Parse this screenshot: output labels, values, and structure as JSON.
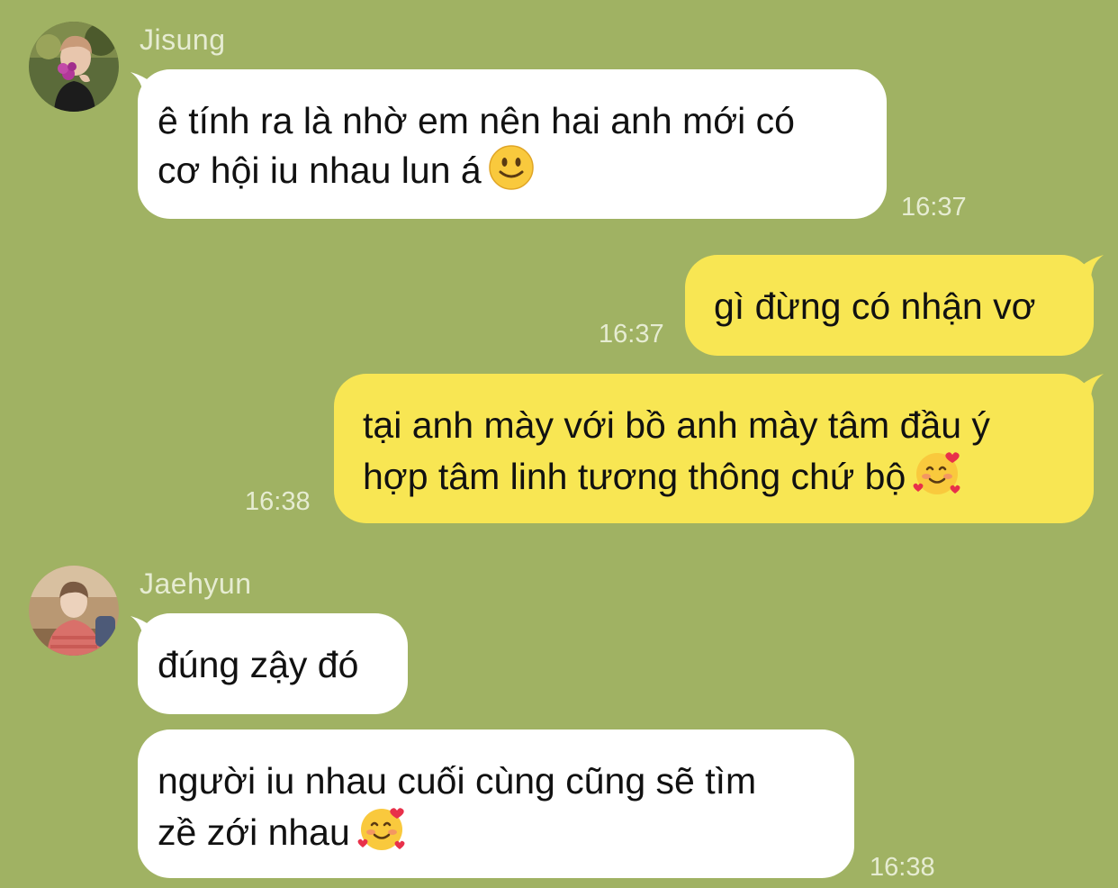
{
  "chat": {
    "messages": [
      {
        "sender": "Jisung",
        "direction": "incoming",
        "lines": [
          "ê tính ra là nhờ em nên hai anh mới có",
          "cơ hội iu nhau lun á"
        ],
        "emoji": "slightly-smiling-face",
        "time": "16:37"
      },
      {
        "direction": "outgoing",
        "lines": [
          "gì đừng có nhận vơ"
        ],
        "time": "16:37"
      },
      {
        "direction": "outgoing",
        "lines": [
          "tại anh mày với bồ anh mày tâm đầu ý",
          "hợp tâm linh tương thông chứ bộ"
        ],
        "emoji": "smiling-face-with-hearts",
        "time": "16:38"
      },
      {
        "sender": "Jaehyun",
        "direction": "incoming",
        "lines": [
          "đúng zậy đó"
        ]
      },
      {
        "direction": "incoming",
        "lines": [
          "người iu nhau cuối cùng cũng sẽ tìm",
          "zề zới nhau"
        ],
        "emoji": "smiling-face-with-hearts",
        "time": "16:38"
      }
    ]
  },
  "colors": {
    "background": "#a0b263",
    "incoming_bubble": "#ffffff",
    "outgoing_bubble": "#f8e653",
    "meta_text": "#e6ecd2"
  }
}
